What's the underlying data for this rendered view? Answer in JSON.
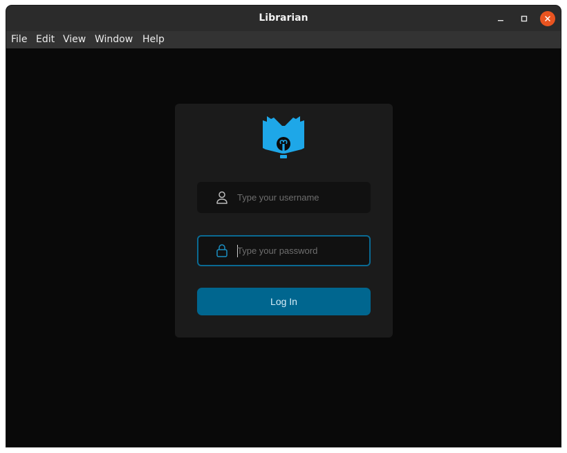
{
  "window": {
    "title": "Librarian"
  },
  "menu": {
    "items": [
      {
        "label": "File"
      },
      {
        "label": "Edit"
      },
      {
        "label": "View"
      },
      {
        "label": "Window"
      },
      {
        "label": "Help"
      }
    ]
  },
  "login": {
    "username_placeholder": "Type your username",
    "username_value": "",
    "password_placeholder": "Type your password",
    "password_value": "",
    "login_label": "Log In"
  },
  "icons": {
    "logo": "book-lightbulb-icon",
    "username": "user-icon",
    "password": "lock-icon",
    "minimize": "minimize-icon",
    "maximize": "maximize-icon",
    "close": "close-icon"
  },
  "colors": {
    "accent": "#0a6a93",
    "button": "#00668f",
    "logo": "#1ea7e8",
    "close": "#e95420",
    "background": "#090909",
    "card": "#1b1b1b"
  }
}
